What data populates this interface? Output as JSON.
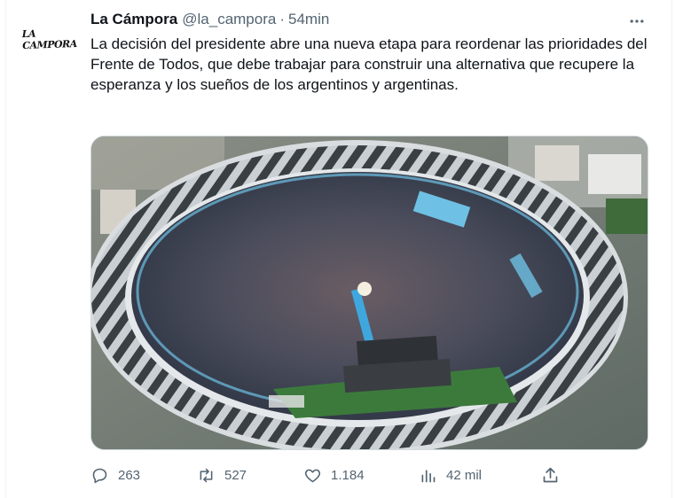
{
  "tweet": {
    "author_name": "La Cámpora",
    "handle": "@la_campora",
    "separator": "·",
    "time": "54min",
    "avatar_text": "LA CAMPORA",
    "text": "La decisión del presidente abre una nueva etapa para reordenar las prioridades del Frente de Todos, que debe trabajar para construir una alternativa que recupere la esperanza y los sueños de los argentinos y argentinas.",
    "media": {
      "description_icon": "stadium-photo",
      "colors": {
        "roof": "#c9cfd2",
        "crowd": "#4a4e5a",
        "field": "#3c7a3c",
        "stage": "#2e3236",
        "banner": "#6ec1e4"
      }
    },
    "actions": {
      "replies": "263",
      "retweets": "527",
      "likes": "1.184",
      "views": "42 mil"
    },
    "icons": {
      "more": "more-icon",
      "reply": "reply-icon",
      "retweet": "retweet-icon",
      "like": "heart-icon",
      "views": "views-icon",
      "share": "share-icon"
    }
  }
}
